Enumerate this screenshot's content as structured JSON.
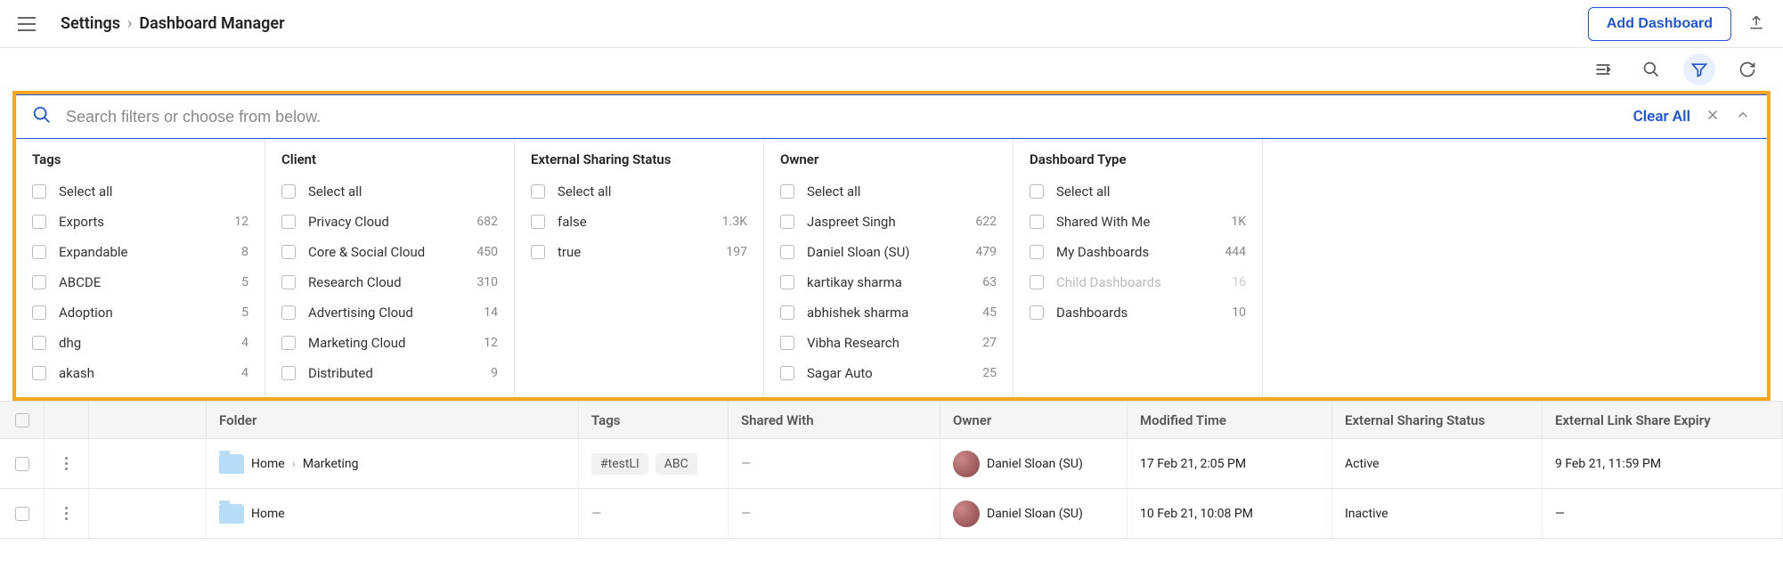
{
  "header": {
    "breadcrumb_root": "Settings",
    "breadcrumb_current": "Dashboard Manager",
    "add_button": "Add Dashboard"
  },
  "search": {
    "placeholder": "Search filters or choose from below.",
    "clear_all": "Clear All"
  },
  "filters": {
    "cols": [
      {
        "title": "Tags",
        "items": [
          {
            "label": "Select all",
            "count": ""
          },
          {
            "label": "Exports",
            "count": "12"
          },
          {
            "label": "Expandable",
            "count": "8"
          },
          {
            "label": "ABCDE",
            "count": "5"
          },
          {
            "label": "Adoption",
            "count": "5"
          },
          {
            "label": "dhg",
            "count": "4"
          },
          {
            "label": "akash",
            "count": "4"
          }
        ]
      },
      {
        "title": "Client",
        "items": [
          {
            "label": "Select all",
            "count": ""
          },
          {
            "label": "Privacy Cloud",
            "count": "682"
          },
          {
            "label": "Core & Social Cloud",
            "count": "450"
          },
          {
            "label": "Research Cloud",
            "count": "310"
          },
          {
            "label": "Advertising Cloud",
            "count": "14"
          },
          {
            "label": "Marketing Cloud",
            "count": "12"
          },
          {
            "label": "Distributed",
            "count": "9"
          }
        ]
      },
      {
        "title": "External Sharing Status",
        "items": [
          {
            "label": "Select all",
            "count": ""
          },
          {
            "label": "false",
            "count": "1.3K"
          },
          {
            "label": "true",
            "count": "197"
          }
        ]
      },
      {
        "title": "Owner",
        "items": [
          {
            "label": "Select all",
            "count": ""
          },
          {
            "label": "Jaspreet Singh",
            "count": "622"
          },
          {
            "label": "Daniel Sloan (SU)",
            "count": "479"
          },
          {
            "label": "kartikay sharma",
            "count": "63"
          },
          {
            "label": "abhishek sharma",
            "count": "45"
          },
          {
            "label": "Vibha Research",
            "count": "27"
          },
          {
            "label": "Sagar Auto",
            "count": "25"
          }
        ]
      },
      {
        "title": "Dashboard Type",
        "items": [
          {
            "label": "Select all",
            "count": ""
          },
          {
            "label": "Shared With Me",
            "count": "1K"
          },
          {
            "label": "My Dashboards",
            "count": "444"
          },
          {
            "label": "Child Dashboards",
            "count": "16",
            "disabled": true
          },
          {
            "label": "Dashboards",
            "count": "10"
          }
        ]
      }
    ]
  },
  "table": {
    "headers": {
      "folder": "Folder",
      "tags": "Tags",
      "shared": "Shared With",
      "owner": "Owner",
      "modified": "Modified Time",
      "ext": "External Sharing Status",
      "exp": "External Link Share Expiry"
    },
    "rows": [
      {
        "folder": [
          "Home",
          "Marketing"
        ],
        "tags": [
          "#testLI",
          "ABC"
        ],
        "shared": "—",
        "owner": "Daniel Sloan (SU)",
        "modified": "17 Feb 21, 2:05 PM",
        "ext": "Active",
        "exp": "9 Feb 21, 11:59 PM"
      },
      {
        "folder": [
          "Home"
        ],
        "tags": [],
        "shared": "—",
        "owner": "Daniel Sloan (SU)",
        "modified": "10 Feb 21, 10:08 PM",
        "ext": "Inactive",
        "exp": "—"
      }
    ]
  }
}
